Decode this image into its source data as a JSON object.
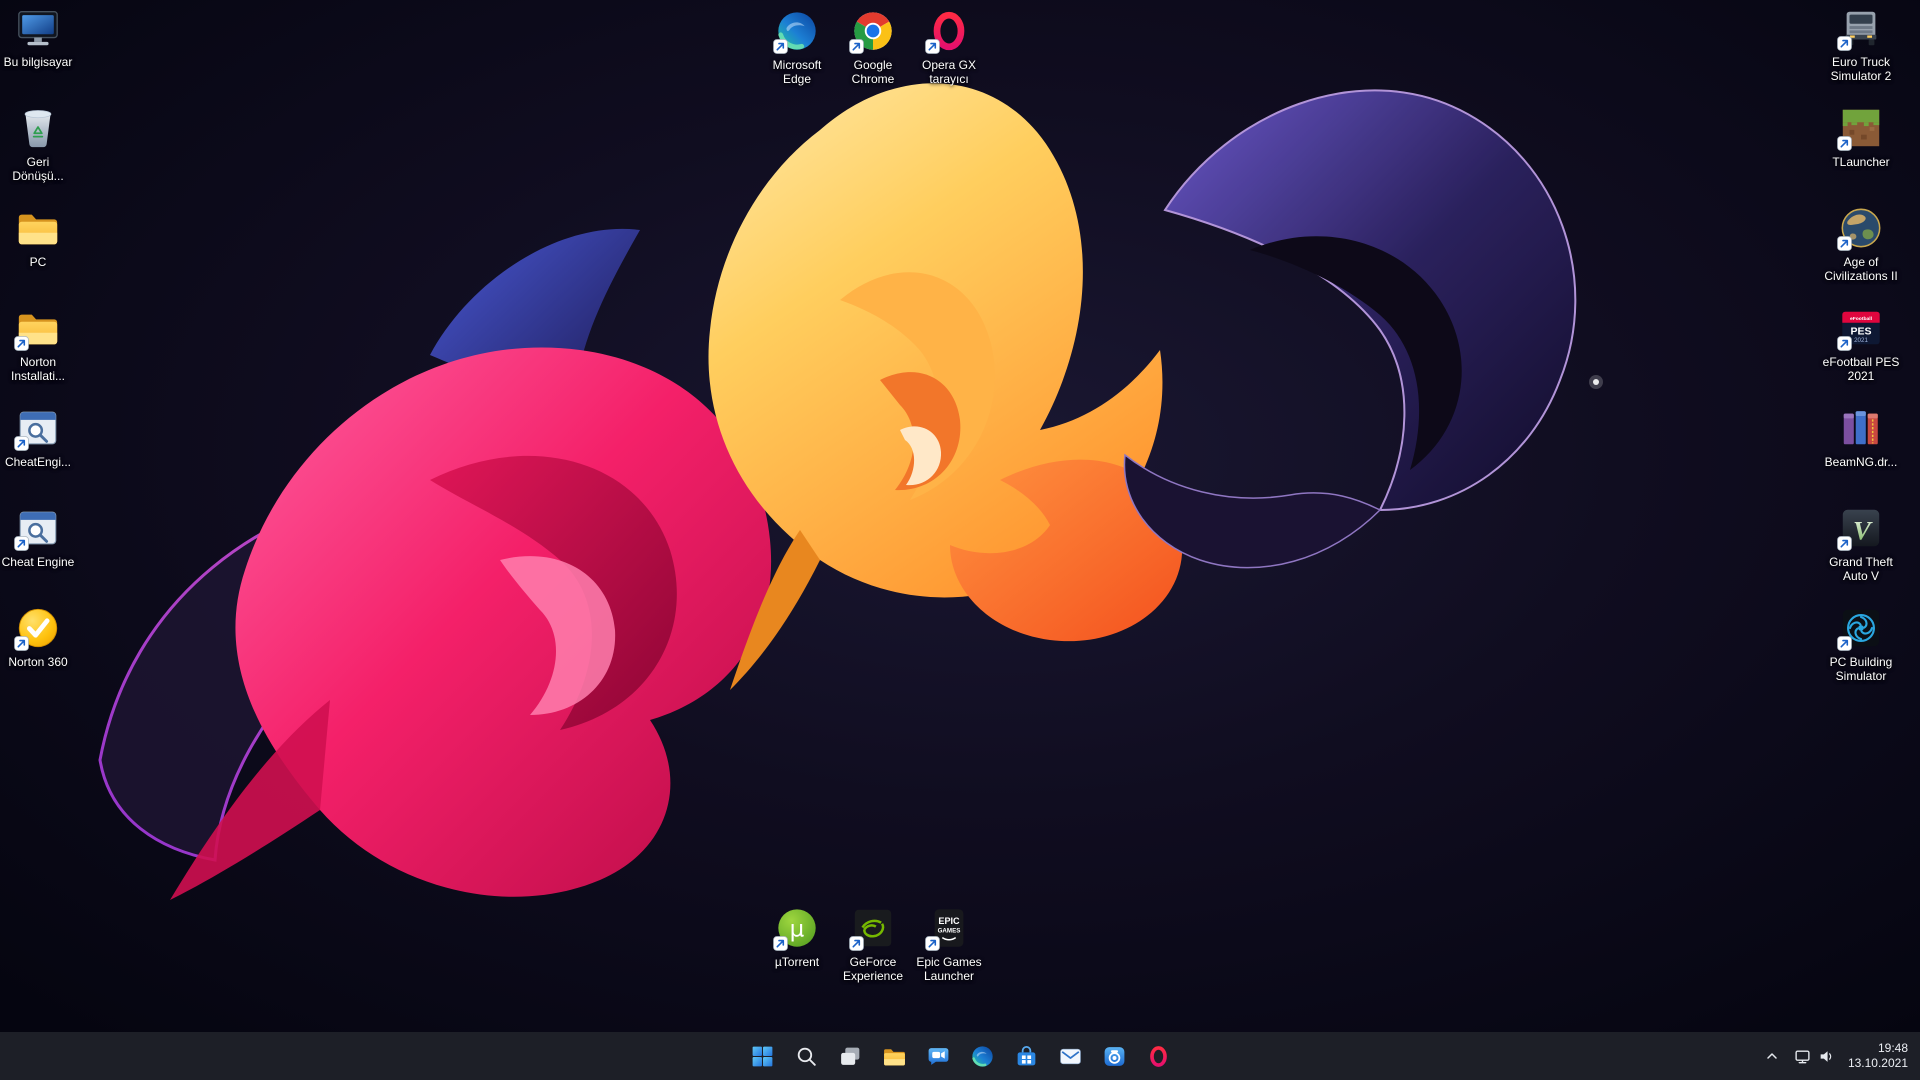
{
  "desktop": {
    "left_column": [
      {
        "label": "Bu bilgisayar",
        "icon": "this-pc",
        "shortcut": false
      },
      {
        "label": "Geri Dönüşü...",
        "icon": "recycle-bin",
        "shortcut": false
      },
      {
        "label": "PC",
        "icon": "folder",
        "shortcut": false
      },
      {
        "label": "Norton Installati...",
        "icon": "folder",
        "shortcut": true
      },
      {
        "label": "CheatEngi...",
        "icon": "cheat-engine",
        "shortcut": true
      },
      {
        "label": "Cheat Engine",
        "icon": "cheat-engine",
        "shortcut": true
      },
      {
        "label": "Norton 360",
        "icon": "norton-360",
        "shortcut": true
      }
    ],
    "top_center": [
      {
        "label": "Microsoft Edge",
        "icon": "edge",
        "shortcut": true
      },
      {
        "label": "Google Chrome",
        "icon": "chrome",
        "shortcut": true
      },
      {
        "label": "Opera GX tarayıcı",
        "icon": "opera-gx",
        "shortcut": true
      }
    ],
    "right_column": [
      {
        "label": "Euro Truck Simulator 2",
        "icon": "ets2",
        "shortcut": true
      },
      {
        "label": "TLauncher",
        "icon": "tlauncher",
        "shortcut": true
      },
      {
        "label": "Age of Civilizations II",
        "icon": "aoc2",
        "shortcut": true
      },
      {
        "label": "eFootball PES 2021",
        "icon": "pes2021",
        "shortcut": true
      },
      {
        "label": "BeamNG.dr...",
        "icon": "winrar",
        "shortcut": false
      },
      {
        "label": "Grand Theft Auto V",
        "icon": "gtav",
        "shortcut": true
      },
      {
        "label": "PC Building Simulator",
        "icon": "pcbs",
        "shortcut": true
      }
    ],
    "bottom_center": [
      {
        "label": "µTorrent",
        "icon": "utorrent",
        "shortcut": true
      },
      {
        "label": "GeForce Experience",
        "icon": "geforce",
        "shortcut": true
      },
      {
        "label": "Epic Games Launcher",
        "icon": "epic",
        "shortcut": true
      }
    ]
  },
  "taskbar": {
    "buttons": [
      {
        "name": "start",
        "icon": "windows-start"
      },
      {
        "name": "search",
        "icon": "search"
      },
      {
        "name": "task-view",
        "icon": "task-view"
      },
      {
        "name": "file-explorer",
        "icon": "file-explorer"
      },
      {
        "name": "chat",
        "icon": "chat-camera"
      },
      {
        "name": "edge",
        "icon": "edge"
      },
      {
        "name": "store",
        "icon": "microsoft-store"
      },
      {
        "name": "mail",
        "icon": "mail"
      },
      {
        "name": "camera",
        "icon": "camera"
      },
      {
        "name": "opera-gx",
        "icon": "opera-gx"
      }
    ],
    "tray": {
      "time": "19:48",
      "date": "13.10.2021"
    }
  },
  "colors": {
    "taskbar_bg": "#1e2029",
    "wallpaper_base": "#0a0816",
    "pink": "#f42069",
    "yellow": "#ffce5e",
    "orange": "#ff8c2e",
    "purple": "#2c2260"
  }
}
